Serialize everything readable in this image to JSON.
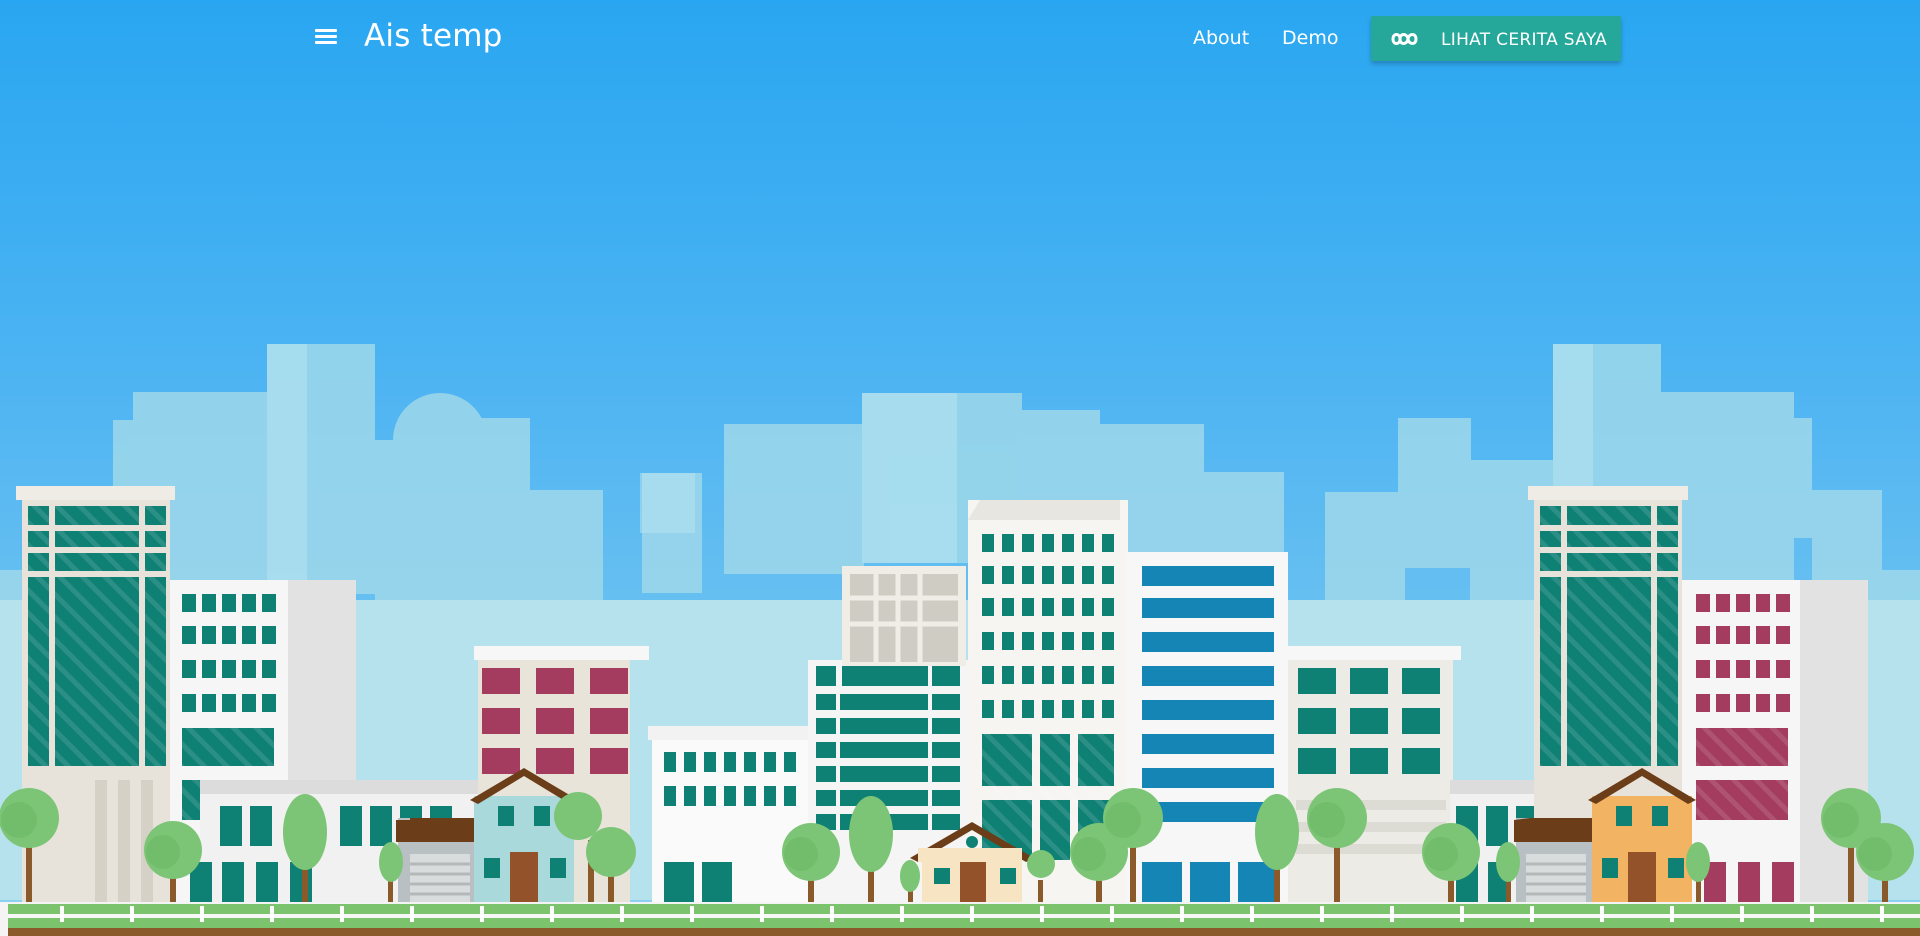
{
  "navbar": {
    "brand": "Ais temp",
    "links": [
      {
        "label": "About"
      },
      {
        "label": "Demo"
      }
    ],
    "cta": {
      "label": "LIHAT CERITA SAYA",
      "icon": "infinity-icon"
    }
  },
  "colors": {
    "sky_top": "#29a6f1",
    "sky_bottom": "#8fd2ef",
    "cta_bg": "#25a89a",
    "grass": "#7bc36d",
    "tree": "#7cc576",
    "building_teal": "#0f8074",
    "building_blue": "#1585b5",
    "building_crimson": "#a33c5f",
    "house_orange": "#f2b463",
    "house_cream": "#f6e4c2"
  },
  "hero": {
    "illustration": "flat-city-skyline"
  }
}
